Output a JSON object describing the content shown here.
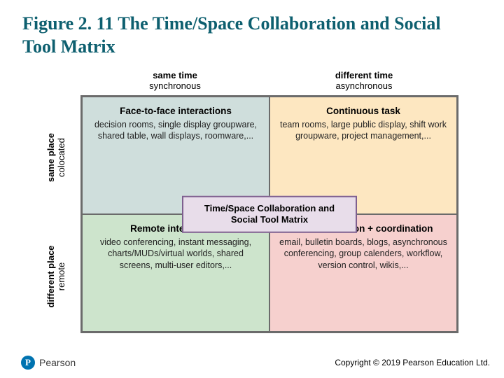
{
  "title": "Figure 2. 11 The Time/Space Collaboration and Social Tool Matrix",
  "colHeaders": [
    {
      "h1": "same time",
      "h2": "synchronous"
    },
    {
      "h1": "different time",
      "h2": "asynchronous"
    }
  ],
  "rowLabels": [
    {
      "h1": "same place",
      "h2": "colocated"
    },
    {
      "h1": "different place",
      "h2": "remote"
    }
  ],
  "quadrants": {
    "q1": {
      "title": "Face-to-face interactions",
      "desc": "decision rooms, single display groupware, shared table, wall displays, roomware,..."
    },
    "q2": {
      "title": "Continuous task",
      "desc": "team rooms, large public display, shift work groupware, project management,..."
    },
    "q3": {
      "title": "Remote interactions",
      "desc": "video conferencing, instant messaging, charts/MUDs/virtual worlds, shared screens, multi-user editors,..."
    },
    "q4": {
      "title": "Communication + coordination",
      "desc": "email, bulletin boards, blogs, asynchronous conferencing, group calenders, workflow, version control, wikis,..."
    }
  },
  "centerLabel": "Time/Space Collaboration and Social Tool Matrix",
  "logo": {
    "badge": "P",
    "text": "Pearson"
  },
  "copyright": "Copyright © 2019 Pearson Education Ltd."
}
